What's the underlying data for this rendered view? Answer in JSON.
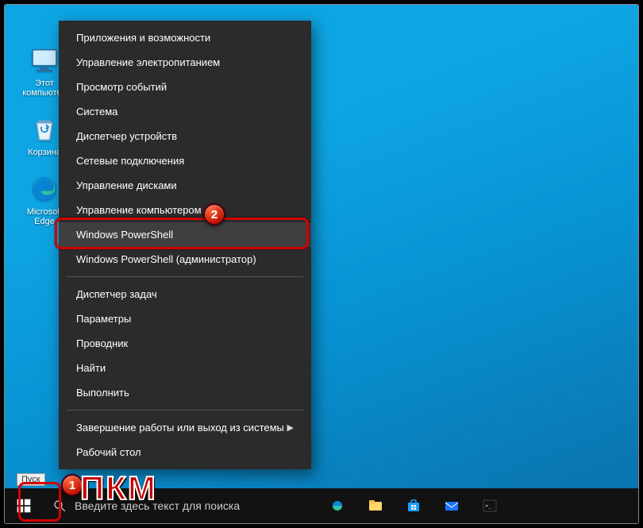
{
  "desktop": {
    "icons": [
      {
        "name": "this-pc",
        "label": "Этот компьютер"
      },
      {
        "name": "recycle-bin",
        "label": "Корзина"
      },
      {
        "name": "edge",
        "label": "Microsoft Edge"
      }
    ]
  },
  "taskbar": {
    "start_tooltip": "Пуск",
    "search_placeholder": "Введите здесь текст для поиска"
  },
  "winx_menu": {
    "items": [
      {
        "label": "Приложения и возможности"
      },
      {
        "label": "Управление электропитанием"
      },
      {
        "label": "Просмотр событий"
      },
      {
        "label": "Система"
      },
      {
        "label": "Диспетчер устройств"
      },
      {
        "label": "Сетевые подключения"
      },
      {
        "label": "Управление дисками"
      },
      {
        "label": "Управление компьютером"
      },
      {
        "label": "Windows PowerShell",
        "highlighted": true
      },
      {
        "label": "Windows PowerShell (администратор)"
      },
      {
        "sep": true
      },
      {
        "label": "Диспетчер задач"
      },
      {
        "label": "Параметры"
      },
      {
        "label": "Проводник"
      },
      {
        "label": "Найти"
      },
      {
        "label": "Выполнить"
      },
      {
        "sep": true
      },
      {
        "label": "Завершение работы или выход из системы",
        "submenu": true
      },
      {
        "label": "Рабочий стол"
      }
    ]
  },
  "annotations": {
    "badge1": "1",
    "badge2": "2",
    "pkm": "ПКМ"
  }
}
